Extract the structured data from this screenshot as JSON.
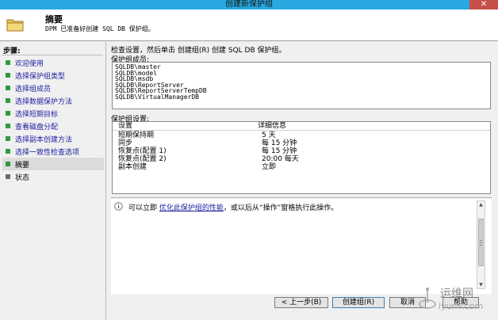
{
  "window": {
    "title": "创建新保护组",
    "close_glyph": "✕"
  },
  "header": {
    "title": "摘要",
    "subtitle": "DPM 已准备好创建 SQL DB 保护组。",
    "icon": "folder-icon"
  },
  "sidebar": {
    "title": "步骤:",
    "items": [
      {
        "label": "欢迎使用"
      },
      {
        "label": "选择保护组类型"
      },
      {
        "label": "选择组成员"
      },
      {
        "label": "选择数据保护方法"
      },
      {
        "label": "选择短期目标"
      },
      {
        "label": "查看磁盘分配"
      },
      {
        "label": "选择副本创建方法"
      },
      {
        "label": "选择一致性检查选项"
      },
      {
        "label": "摘要"
      },
      {
        "label": "状态"
      }
    ]
  },
  "main": {
    "instruction": "检查设置，然后单击 创建组(R) 创建 SQL DB 保护组。",
    "members_label": "保护组成员:",
    "members": [
      "SQLDB\\master",
      "SQLDB\\model",
      "SQLDB\\msdb",
      "SQLDB\\ReportServer",
      "SQLDB\\ReportServerTempDB",
      "SQLDB\\VirtualManagerDB"
    ],
    "settings_label": "保护组设置:",
    "settings_headers": [
      "设置",
      "详细信息"
    ],
    "settings_rows": [
      [
        "短期保持期",
        "5 天"
      ],
      [
        "同步",
        "每 15 分钟"
      ],
      [
        "恢复点(配置 1)",
        "每 15 分钟"
      ],
      [
        "恢复点(配置 2)",
        "20:00 每天"
      ],
      [
        "副本创建",
        "立即"
      ]
    ],
    "info": {
      "prefix": "可以立即",
      "link": "优化此保护组的性能",
      "suffix": "，或以后从“操作”窗格执行此操作。",
      "icon": "info-icon"
    }
  },
  "buttons": {
    "back": "< 上一步(B)",
    "create": "创建组(R)",
    "cancel": "取消",
    "help": "帮助"
  },
  "watermark": {
    "line1": "运维网",
    "line2": "iyunv.com"
  },
  "colors": {
    "titlebar": "#28a8e0",
    "close": "#c7504a",
    "link": "#1c1ca0",
    "bullet": "#2e9a3c"
  }
}
